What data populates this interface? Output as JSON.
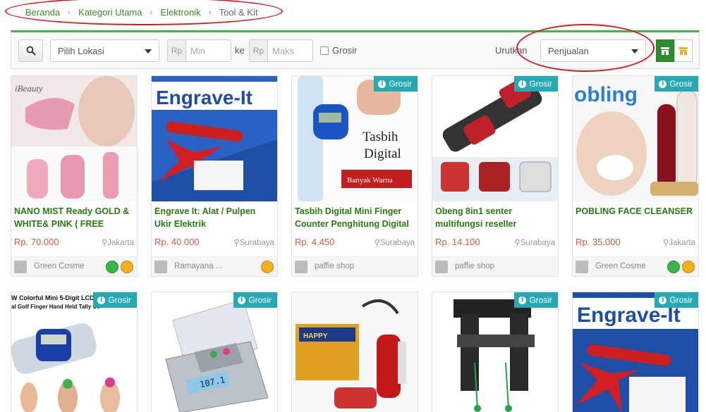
{
  "breadcrumb": [
    "Beranda",
    "Kategori Utama",
    "Elektronik",
    "Tool & Kit"
  ],
  "filters": {
    "location": "Pilih Lokasi",
    "currency": "Rp",
    "min_placeholder": "Min",
    "to_label": "ke",
    "max_placeholder": "Maks",
    "grosir_label": "Grosir",
    "sort_label": "Urutkan",
    "sort_value": "Penjualan"
  },
  "grosir_badge": "Grosir",
  "products": [
    {
      "name": "NANO MIST Ready GOLD & WHITE& PINK ( FREE",
      "price": "Rp. 70.000",
      "location": "Jakarta",
      "shop": "Green Cosme",
      "grosir": false,
      "badges": [
        "green",
        "gold"
      ]
    },
    {
      "name": "Engrave It: Alat / Pulpen Ukir Elektrik",
      "price": "Rp. 40.000",
      "location": "Surabaya",
      "shop": "Ramayana ...",
      "grosir": false,
      "badges": [
        "gold"
      ]
    },
    {
      "name": "Tasbih Digital Mini Finger Counter Penghitung Digital",
      "price": "Rp. 4.450",
      "location": "Surabaya",
      "shop": "paffie shop",
      "grosir": true,
      "badges": []
    },
    {
      "name": "Obeng 8in1 senter multifungsi reseller",
      "price": "Rp. 14.100",
      "location": "Surabaya",
      "shop": "paffie shop",
      "grosir": true,
      "badges": []
    },
    {
      "name": "POBLING FACE CLEANSER",
      "price": "Rp. 35.000",
      "location": "Jakarta",
      "shop": "Green Cosme",
      "grosir": true,
      "badges": [
        "green",
        "gold"
      ]
    },
    {
      "grosir": true
    },
    {
      "grosir": true
    },
    {
      "grosir": false
    },
    {
      "grosir": true
    },
    {
      "grosir": true
    }
  ],
  "thumb_texts": {
    "ibeauty": "iBeauty",
    "engrave": "Engrave-It",
    "tasbih": [
      "Tasbih",
      "Digital"
    ],
    "banyak": "Banyak Warna",
    "pobling": "obling",
    "lcd_line1": "W Colorful Mini 5-Digit LCD",
    "lcd_line2": "al Golf Finger Hand Held Tally Co",
    "scale_reading": "107.1",
    "happy": "HAPPY"
  },
  "colors": {
    "accent_green": "#42b549",
    "grosir_teal": "#27a9b4",
    "price_red": "#d65a44",
    "annotation_red": "#d21f26"
  }
}
